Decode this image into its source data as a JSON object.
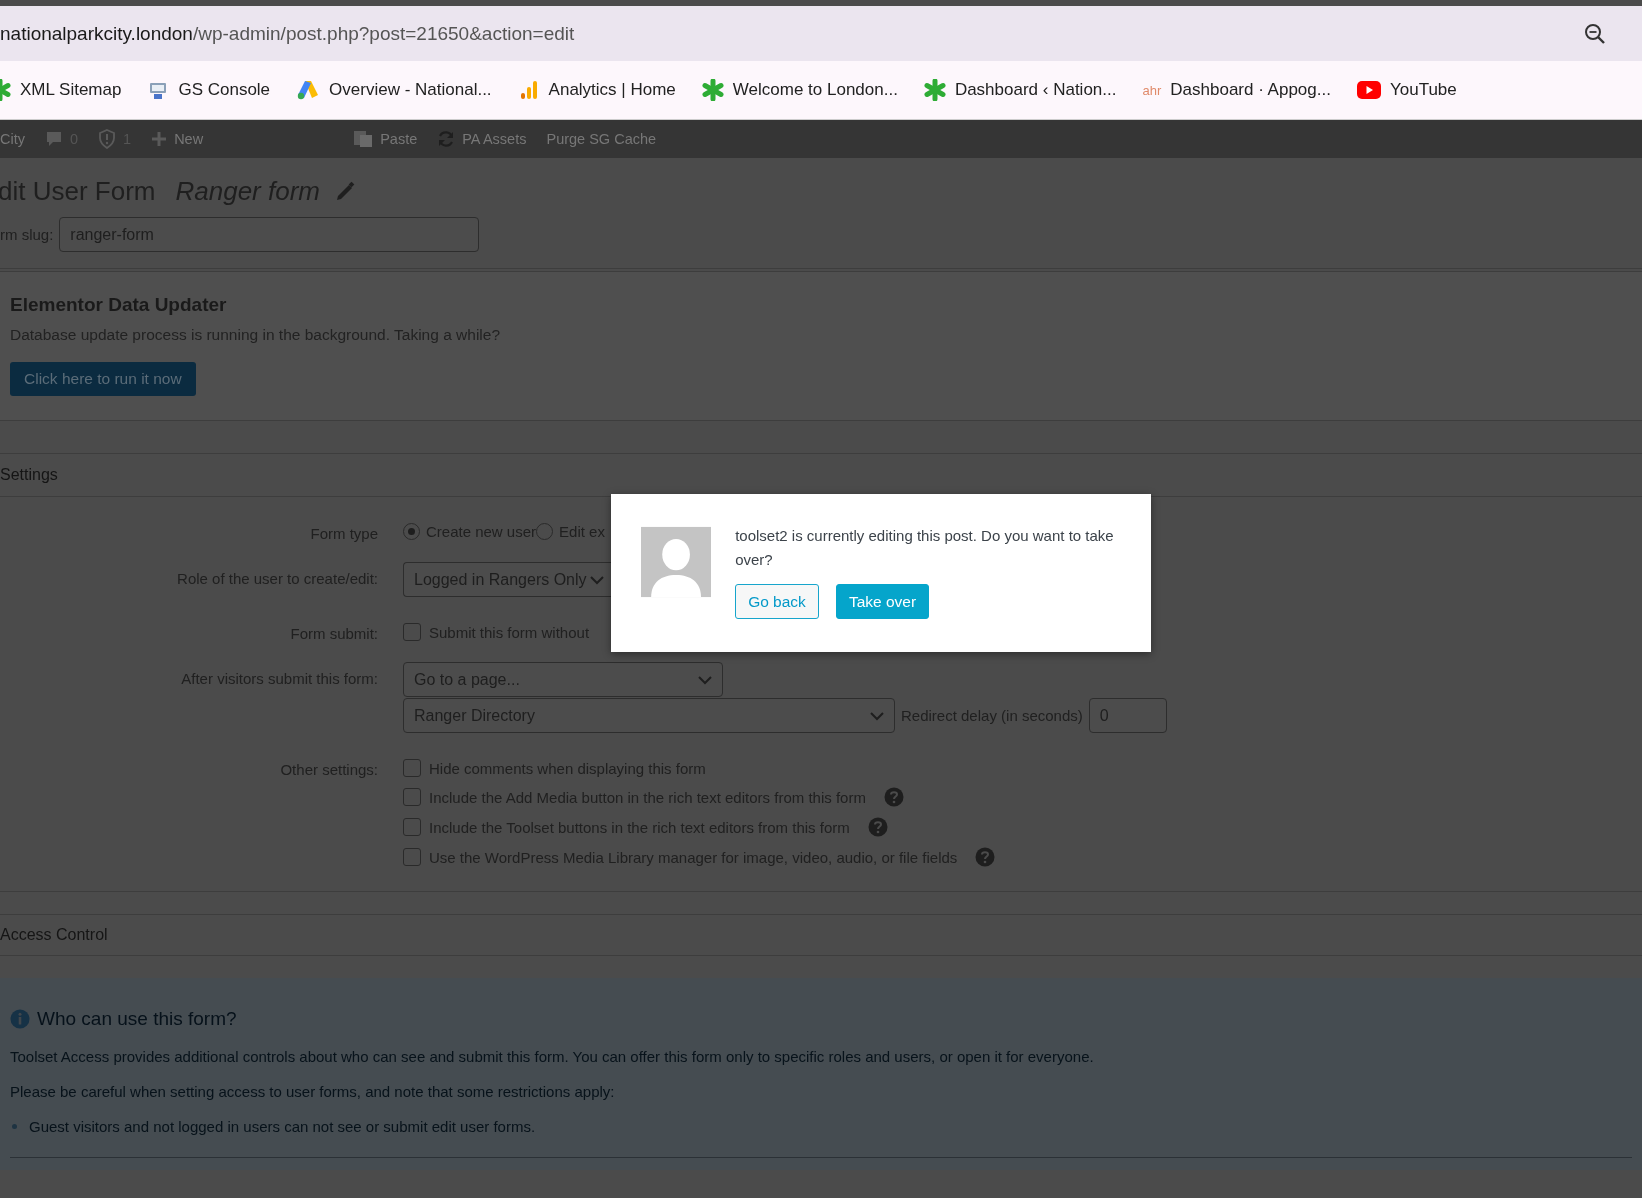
{
  "browser": {
    "url_domain": "nationalparkcity.london",
    "url_path": "/wp-admin/post.php?post=21650&action=edit"
  },
  "bookmarks": [
    {
      "label": "XML Sitemap",
      "kind": "asterisk"
    },
    {
      "label": "GS Console",
      "kind": "console"
    },
    {
      "label": "Overview - National...",
      "kind": "ads"
    },
    {
      "label": "Analytics | Home",
      "kind": "analytics"
    },
    {
      "label": "Welcome to London...",
      "kind": "asterisk"
    },
    {
      "label": "Dashboard ‹ Nation...",
      "kind": "asterisk"
    },
    {
      "label": "Dashboard · Appog...",
      "kind": "ahr",
      "icon_text": "ahr"
    },
    {
      "label": "YouTube",
      "kind": "youtube"
    }
  ],
  "admin_bar": [
    {
      "kind": "text",
      "label": "City"
    },
    {
      "kind": "comments",
      "label": "0"
    },
    {
      "kind": "shield",
      "label": "1"
    },
    {
      "kind": "new",
      "label": "New"
    },
    {
      "kind": "paste",
      "label": "Paste"
    },
    {
      "kind": "refresh",
      "label": "PA Assets"
    },
    {
      "kind": "text",
      "label": "Purge SG Cache"
    }
  ],
  "header": {
    "title": "dit User Form",
    "form_name": "Ranger form",
    "slug_label": "rm slug:",
    "slug_value": "ranger-form"
  },
  "notice": {
    "title": "Elementor Data Updater",
    "text": "Database update process is running in the background. Taking a while?",
    "button": "Click here to run it now"
  },
  "settings": {
    "title": "Settings",
    "rows": [
      {
        "label": "Form type",
        "kind": "radio",
        "options": [
          {
            "label": "Create new user",
            "selected": true
          },
          {
            "label": "Edit ex",
            "selected": false
          }
        ]
      },
      {
        "label": "Role of the user to create/edit:",
        "kind": "select",
        "value": "Logged in Rangers Only"
      },
      {
        "label": "Form submit:",
        "kind": "checkboxes",
        "options": [
          {
            "label": "Submit this form without",
            "checked": false,
            "help": false
          }
        ]
      },
      {
        "label": "After visitors submit this form:",
        "kind": "redirect",
        "value": "Go to a page...",
        "page": "Ranger Directory",
        "delay_label": "Redirect delay (in seconds)",
        "delay_value": "0"
      },
      {
        "label": "Other settings:",
        "kind": "checkboxes",
        "options": [
          {
            "label": "Hide comments when displaying this form",
            "checked": false,
            "help": false
          },
          {
            "label": "Include the Add Media button in the rich text editors from this form",
            "checked": false,
            "help": true
          },
          {
            "label": "Include the Toolset buttons in the rich text editors from this form",
            "checked": false,
            "help": true
          },
          {
            "label": "Use the WordPress Media Library manager for image, video, audio, or file fields",
            "checked": false,
            "help": true
          }
        ]
      }
    ]
  },
  "access": {
    "title": "Access Control",
    "panel_title": "Who can use this form?",
    "paragraphs": [
      "Toolset Access provides additional controls about who can see and submit this form. You can offer this form only to specific roles and users, or open it for everyone.",
      "Please be careful when setting access to user forms, and note that some restrictions apply:"
    ],
    "bullets": [
      "Guest visitors and not logged in users can not see or submit edit user forms."
    ]
  },
  "dialog": {
    "message": "toolset2 is currently editing this post. Do you want to take over?",
    "buttons": [
      {
        "label": "Go back",
        "kind": "secondary"
      },
      {
        "label": "Take over",
        "kind": "primary"
      }
    ]
  }
}
